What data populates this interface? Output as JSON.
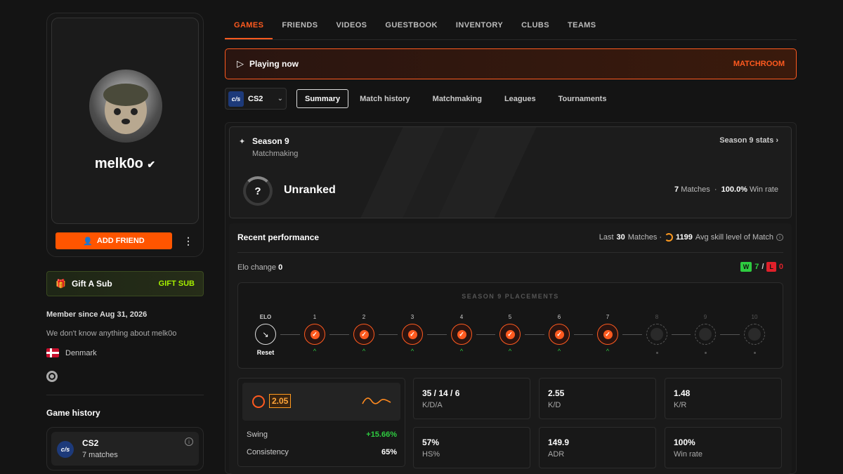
{
  "profile": {
    "username": "melk0o",
    "add_friend": "ADD FRIEND",
    "more": "⋮"
  },
  "gift": {
    "label": "Gift A Sub",
    "button": "GIFT SUB"
  },
  "about": {
    "member_since": "Member since Aug 31, 2026",
    "bio": "We don't know anything about melk0o",
    "country": "Denmark"
  },
  "game_history": {
    "title": "Game history",
    "game": "CS2",
    "matches": "7 matches",
    "logo": "c/s"
  },
  "nav": [
    "GAMES",
    "FRIENDS",
    "VIDEOS",
    "GUESTBOOK",
    "INVENTORY",
    "CLUBS",
    "TEAMS"
  ],
  "playing": {
    "label": "Playing now",
    "action": "MATCHROOM"
  },
  "game_select": {
    "value": "CS2",
    "logo": "c/s"
  },
  "subtabs": [
    "Summary",
    "Match history",
    "Matchmaking",
    "Leagues",
    "Tournaments"
  ],
  "season": {
    "title": "Season 9",
    "subtitle": "Matchmaking",
    "stats_link": "Season 9 stats",
    "rank": "Unranked",
    "rank_icon": "?",
    "matches": "7",
    "matches_label": "Matches",
    "winrate": "100.0%",
    "winrate_label": "Win rate"
  },
  "performance": {
    "title": "Recent performance",
    "last_label": "Last",
    "last_count": "30",
    "last_suffix": "Matches ·",
    "skill": "1199",
    "skill_label": "Avg skill level of Match",
    "elo_label": "Elo change",
    "elo_value": "0",
    "wins": "7",
    "losses": "0",
    "w": "W",
    "l": "L",
    "slash": "/"
  },
  "placements": {
    "title": "SEASON 9 PLACEMENTS",
    "elo_label": "ELO",
    "reset": "Reset",
    "nodes": [
      "1",
      "2",
      "3",
      "4",
      "5",
      "6",
      "7",
      "8",
      "9",
      "10"
    ],
    "completed": 7
  },
  "rating": {
    "value": "2.05",
    "swing_label": "Swing",
    "swing": "+15.66%",
    "consistency_label": "Consistency",
    "consistency": "65%"
  },
  "stats": [
    {
      "value": "35 / 14 / 6",
      "label": "K/D/A"
    },
    {
      "value": "2.55",
      "label": "K/D"
    },
    {
      "value": "1.48",
      "label": "K/R"
    },
    {
      "value": "57%",
      "label": "HS%"
    },
    {
      "value": "149.9",
      "label": "ADR"
    },
    {
      "value": "100%",
      "label": "Win rate"
    }
  ],
  "colors": {
    "accent": "#ff5a1f",
    "gift": "#a6f000",
    "win": "#2ecc40",
    "loss": "#e0202a"
  }
}
